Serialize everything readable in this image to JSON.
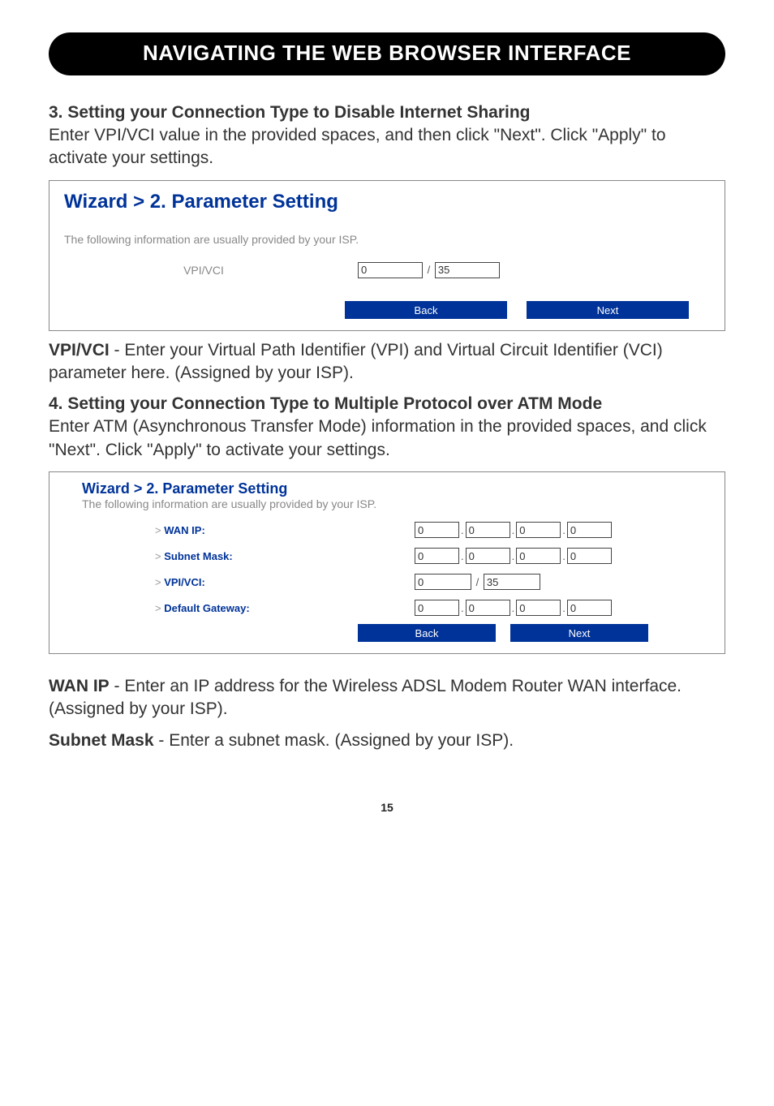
{
  "banner": "NAVIGATING THE WEB BROWSER INTERFACE",
  "sec3": {
    "heading": "3. Setting your Connection Type to Disable Internet Sharing",
    "body": "Enter VPI/VCI value in the provided spaces, and then click \"Next\". Click \"Apply\" to activate your settings."
  },
  "shot1": {
    "title": "Wizard > 2. Parameter Setting",
    "info": "The following information are usually provided by your ISP.",
    "vpi_vci_label": "VPI/VCI",
    "vpi": "0",
    "vci": "35",
    "back": "Back",
    "next": "Next"
  },
  "def_vpi_label": "VPI/VCI",
  "def_vpi_body": " - Enter your Virtual Path Identifier (VPI) and Virtual Circuit Identifier (VCI) parameter here. (Assigned by your ISP).",
  "sec4": {
    "heading": "4. Setting your Connection Type to Multiple Protocol over ATM Mode",
    "body": "Enter ATM (Asynchronous Transfer Mode) information in the provided spaces, and click \"Next\". Click \"Apply\" to activate your settings."
  },
  "shot2": {
    "title": "Wizard > 2. Parameter Setting",
    "info": "The following information are usually provided by your ISP.",
    "wan_ip_label": "WAN IP:",
    "wan_ip": [
      "0",
      "0",
      "0",
      "0"
    ],
    "subnet_label": "Subnet Mask:",
    "subnet": [
      "0",
      "0",
      "0",
      "0"
    ],
    "vpi_vci_label": "VPI/VCI:",
    "vpi": "0",
    "vci": "35",
    "gateway_label": "Default Gateway:",
    "gateway": [
      "0",
      "0",
      "0",
      "0"
    ],
    "back": "Back",
    "next": "Next",
    "gt": "> "
  },
  "def_wan_label": "WAN IP",
  "def_wan_body": " - Enter an IP address for the Wireless ADSL Modem Router WAN interface. (Assigned by your ISP).",
  "def_subnet_label": "Subnet Mask",
  "def_subnet_body": " - Enter a subnet mask. (Assigned by your ISP).",
  "page_num": "15"
}
